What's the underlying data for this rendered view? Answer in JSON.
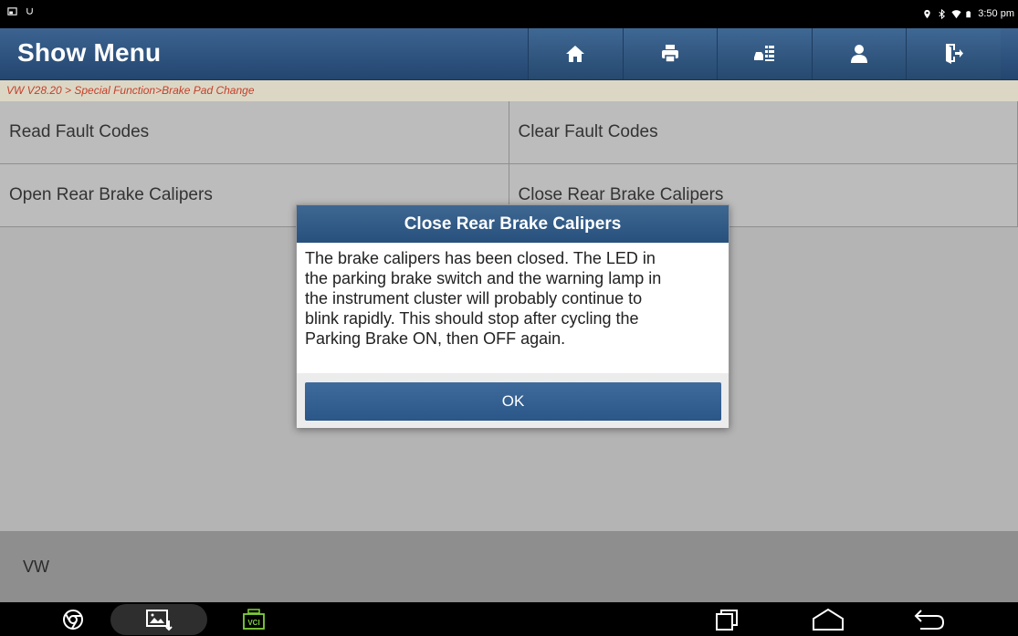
{
  "status_bar": {
    "time": "3:50 pm",
    "icons": [
      "screenshot-icon",
      "usb-debug-icon",
      "location-icon",
      "bluetooth-icon",
      "wifi-icon",
      "battery-icon"
    ]
  },
  "header": {
    "title": "Show Menu",
    "toolbar": [
      "home-icon",
      "print-icon",
      "vehicle-report-icon",
      "user-icon",
      "exit-icon"
    ]
  },
  "breadcrumb": "VW V28.20 > Special Function>Brake Pad Change",
  "menu": {
    "items": [
      "Read Fault Codes",
      "Clear Fault Codes",
      "Open Rear Brake Calipers",
      "Close Rear Brake Calipers"
    ]
  },
  "footer_label": "VW",
  "dialog": {
    "title": "Close Rear Brake Calipers",
    "lines": [
      "The brake calipers has been closed. The LED in",
      "the parking brake switch and the warning lamp in",
      "the instrument cluster will probably continue to",
      "blink rapidly. This should stop after cycling the",
      "Parking Brake ON, then OFF again."
    ],
    "ok_label": "OK"
  },
  "nav_bar": {
    "vci_label": "VCI",
    "icons": [
      "chrome-icon",
      "gallery-icon",
      "vci-icon",
      "recent-apps-icon",
      "home-nav-icon",
      "back-icon"
    ]
  },
  "colors": {
    "header": "#2f5580",
    "breadcrumb_text": "#c43f2a",
    "breadcrumb_bg": "#dcd7c5",
    "menu_bg": "#bcbcbc",
    "vci_green": "#7fd13b"
  }
}
